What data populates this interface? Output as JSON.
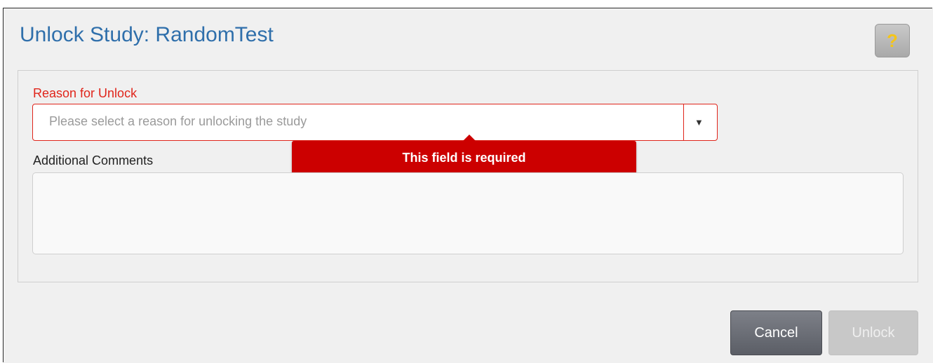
{
  "dialog": {
    "title": "Unlock Study: RandomTest",
    "help_label": "?"
  },
  "form": {
    "reason_label": "Reason for Unlock",
    "reason_placeholder": "Please select a reason for unlocking the study",
    "reason_value": "",
    "dropdown_arrow": "▼",
    "validation_message": "This field is required",
    "comments_label": "Additional Comments",
    "comments_value": ""
  },
  "buttons": {
    "cancel_label": "Cancel",
    "unlock_label": "Unlock"
  },
  "colors": {
    "title": "#2f6fab",
    "error": "#e0251b",
    "tooltip_bg": "#cc0000",
    "help_question_mark": "#f5c518"
  },
  "icons": {
    "help": "question-mark-icon",
    "dropdown": "chevron-down-icon"
  }
}
